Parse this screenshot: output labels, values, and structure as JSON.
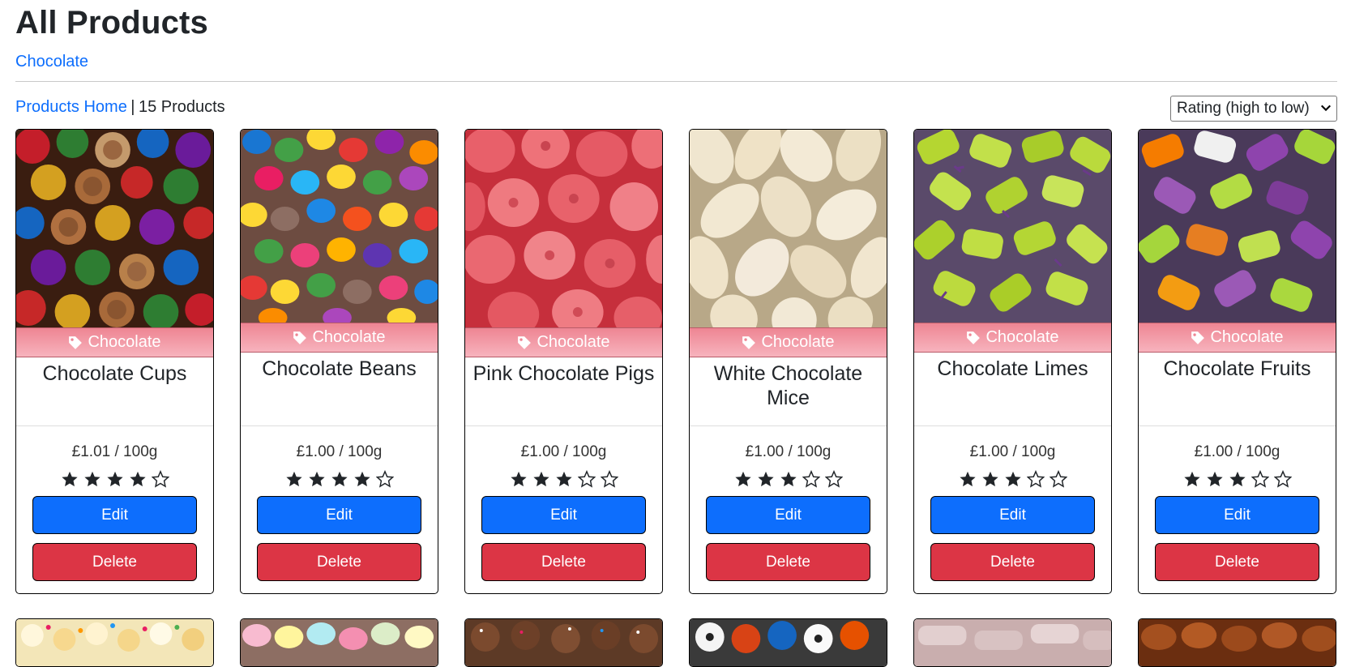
{
  "header": {
    "title": "All Products",
    "category_link": "Chocolate"
  },
  "toolbar": {
    "home_link": "Products Home",
    "separator": "|",
    "count": "15 Products",
    "sort_selected": "Rating (high to low)"
  },
  "colors": {
    "link": "#0d6efd",
    "edit": "#0d6efd",
    "delete": "#dc3545",
    "tag_bar": "#f29aa6"
  },
  "products": [
    {
      "category": "Chocolate",
      "name": "Chocolate Cups",
      "price": "£1.01 / 100g",
      "rating": 4,
      "edit_label": "Edit",
      "delete_label": "Delete",
      "image": "chocolate-cups"
    },
    {
      "category": "Chocolate",
      "name": "Chocolate Beans",
      "price": "£1.00 / 100g",
      "rating": 4,
      "edit_label": "Edit",
      "delete_label": "Delete",
      "image": "chocolate-beans"
    },
    {
      "category": "Chocolate",
      "name": "Pink Chocolate Pigs",
      "price": "£1.00 / 100g",
      "rating": 3,
      "edit_label": "Edit",
      "delete_label": "Delete",
      "image": "pink-pigs"
    },
    {
      "category": "Chocolate",
      "name": "White Chocolate Mice",
      "price": "£1.00 / 100g",
      "rating": 3,
      "edit_label": "Edit",
      "delete_label": "Delete",
      "image": "white-mice"
    },
    {
      "category": "Chocolate",
      "name": "Chocolate Limes",
      "price": "£1.00 / 100g",
      "rating": 3,
      "edit_label": "Edit",
      "delete_label": "Delete",
      "image": "chocolate-limes"
    },
    {
      "category": "Chocolate",
      "name": "Chocolate Fruits",
      "price": "£1.00 / 100g",
      "rating": 3,
      "edit_label": "Edit",
      "delete_label": "Delete",
      "image": "chocolate-fruits"
    }
  ]
}
